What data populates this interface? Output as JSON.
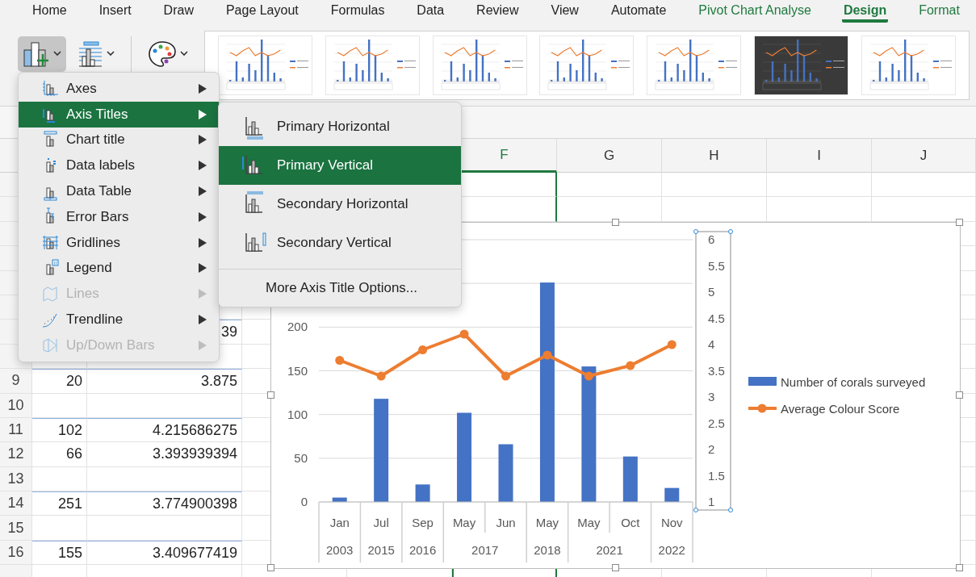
{
  "tabs": [
    {
      "label": "Home",
      "selected": false,
      "contextual": false
    },
    {
      "label": "Insert",
      "selected": false,
      "contextual": false
    },
    {
      "label": "Draw",
      "selected": false,
      "contextual": false
    },
    {
      "label": "Page Layout",
      "selected": false,
      "contextual": false
    },
    {
      "label": "Formulas",
      "selected": false,
      "contextual": false
    },
    {
      "label": "Data",
      "selected": false,
      "contextual": false
    },
    {
      "label": "Review",
      "selected": false,
      "contextual": false
    },
    {
      "label": "View",
      "selected": false,
      "contextual": false
    },
    {
      "label": "Automate",
      "selected": false,
      "contextual": false
    },
    {
      "label": "Pivot Chart Analyse",
      "selected": false,
      "contextual": true
    },
    {
      "label": "Design",
      "selected": true,
      "contextual": true
    },
    {
      "label": "Format",
      "selected": false,
      "contextual": true
    }
  ],
  "ribbon": {
    "buttons": [
      {
        "selected": true
      },
      {
        "selected": false
      },
      {
        "selected": false
      }
    ],
    "chart_styles": [
      {
        "dark": false
      },
      {
        "dark": false
      },
      {
        "dark": false
      },
      {
        "dark": false
      },
      {
        "dark": false
      },
      {
        "dark": true
      },
      {
        "dark": false
      }
    ]
  },
  "chart_element_menu": {
    "items": [
      {
        "label": "Axes",
        "selected": false,
        "disabled": false
      },
      {
        "label": "Axis Titles",
        "selected": true,
        "disabled": false
      },
      {
        "label": "Chart title",
        "selected": false,
        "disabled": false
      },
      {
        "label": "Data labels",
        "selected": false,
        "disabled": false
      },
      {
        "label": "Data Table",
        "selected": false,
        "disabled": false
      },
      {
        "label": "Error Bars",
        "selected": false,
        "disabled": false
      },
      {
        "label": "Gridlines",
        "selected": false,
        "disabled": false
      },
      {
        "label": "Legend",
        "selected": false,
        "disabled": false
      },
      {
        "label": "Lines",
        "selected": false,
        "disabled": true
      },
      {
        "label": "Trendline",
        "selected": false,
        "disabled": false
      },
      {
        "label": "Up/Down Bars",
        "selected": false,
        "disabled": true
      }
    ]
  },
  "axis_titles_submenu": {
    "items": [
      {
        "kind": "option",
        "label": "Primary Horizontal",
        "selected": false
      },
      {
        "kind": "option",
        "label": "Primary Vertical",
        "selected": true
      },
      {
        "kind": "option",
        "label": "Secondary Horizontal",
        "selected": false
      },
      {
        "kind": "option",
        "label": "Secondary Vertical",
        "selected": false
      },
      {
        "kind": "more",
        "label": "More Axis Title Options...",
        "selected": false
      }
    ]
  },
  "sheet": {
    "columns": [
      {
        "label": "F",
        "selected": true
      },
      {
        "label": "G",
        "selected": false
      },
      {
        "label": "H",
        "selected": false
      },
      {
        "label": "I",
        "selected": false
      },
      {
        "label": "J",
        "selected": false
      }
    ],
    "rows": [
      {
        "b": "39",
        "group_start": true
      },
      {
        "group_start": false
      },
      {
        "number": "9",
        "a": "20",
        "b": "3.875",
        "group_start": true
      },
      {
        "number": "10",
        "group_start": false
      },
      {
        "number": "11",
        "a": "102",
        "b": "4.215686275",
        "group_start": true
      },
      {
        "number": "12",
        "a": "66",
        "b": "3.393939394",
        "group_start": false
      },
      {
        "number": "13",
        "group_start": false
      },
      {
        "number": "14",
        "a": "251",
        "b": "3.774900398",
        "group_start": true
      },
      {
        "number": "15",
        "group_start": false
      },
      {
        "number": "16",
        "a": "155",
        "b": "3.409677419",
        "group_start": true
      }
    ]
  },
  "chart": {
    "selected": true,
    "secondary_axis_selected": true,
    "category_years": [
      {
        "year": "2003",
        "group_start": true
      },
      {
        "year": "2015",
        "group_start": true
      },
      {
        "year": "2016",
        "group_start": true
      },
      {
        "year": "2017",
        "group_start": true
      },
      {
        "group_start": false
      },
      {
        "year": "2018",
        "group_start": true
      },
      {
        "year": "2021",
        "group_start": true
      },
      {
        "group_start": false
      },
      {
        "year": "2022",
        "group_start": true
      }
    ],
    "chart_data": {
      "type": "bar",
      "categories": [
        "Jan",
        "Jul",
        "Sep",
        "May",
        "Jun",
        "May",
        "May",
        "Oct",
        "Nov"
      ],
      "grid": true,
      "legend": "right",
      "ylim": [
        0,
        300
      ],
      "yticks": [
        0,
        50,
        100,
        150,
        200
      ],
      "y2lim": [
        1,
        6
      ],
      "y2ticks": [
        1,
        1.5,
        2,
        2.5,
        3,
        3.5,
        4,
        4.5,
        5,
        5.5,
        6
      ],
      "series": [
        {
          "name": "Number of corals surveyed",
          "type": "bar",
          "color": "#4472c4",
          "values": [
            5,
            118,
            20,
            102,
            66,
            251,
            155,
            52,
            16
          ]
        },
        {
          "name": "Average Colour Score",
          "type": "line",
          "axis": "y2",
          "marker": "circle",
          "color": "#ed7d31",
          "values": [
            3.7,
            3.4,
            3.9,
            4.2,
            3.4,
            3.8,
            3.4,
            3.6,
            4
          ]
        }
      ]
    }
  }
}
